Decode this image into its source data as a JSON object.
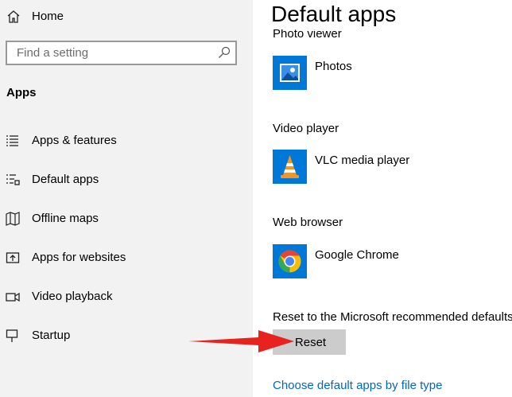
{
  "sidebar": {
    "home_label": "Home",
    "search_placeholder": "Find a setting",
    "section_title": "Apps",
    "items": [
      {
        "label": "Apps & features",
        "icon": "list-icon"
      },
      {
        "label": "Default apps",
        "icon": "default-apps-icon"
      },
      {
        "label": "Offline maps",
        "icon": "map-icon"
      },
      {
        "label": "Apps for websites",
        "icon": "open-in-app-icon"
      },
      {
        "label": "Video playback",
        "icon": "video-icon"
      },
      {
        "label": "Startup",
        "icon": "startup-icon"
      }
    ]
  },
  "main": {
    "title": "Default apps",
    "categories": [
      {
        "label": "Photo viewer",
        "app": "Photos",
        "icon": "photos-icon"
      },
      {
        "label": "Video player",
        "app": "VLC media player",
        "icon": "vlc-icon"
      },
      {
        "label": "Web browser",
        "app": "Google Chrome",
        "icon": "chrome-icon"
      }
    ],
    "reset_label": "Reset to the Microsoft recommended defaults",
    "reset_button": "Reset",
    "file_type_link": "Choose default apps by file type"
  },
  "colors": {
    "sidebar_bg": "#f2f2f2",
    "accent": "#0067c0",
    "arrow": "#e8231f",
    "button_bg": "#cccccc"
  }
}
